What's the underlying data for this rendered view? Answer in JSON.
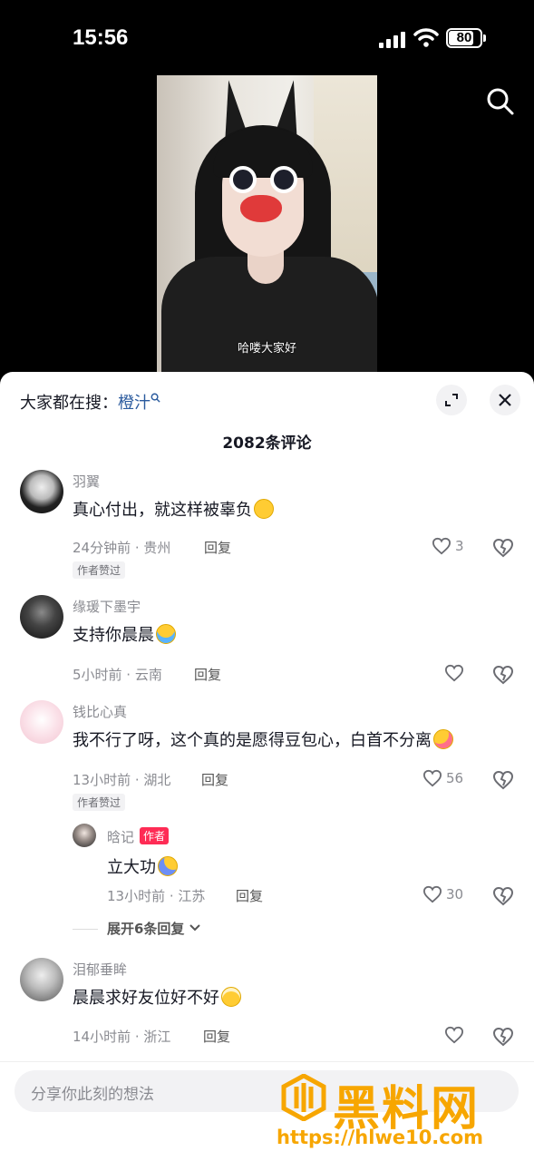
{
  "status_bar": {
    "time": "15:56",
    "battery": "80",
    "battery_level": 0.8
  },
  "video": {
    "subtitle": "哈喽大家好"
  },
  "sheet": {
    "search_prefix": "大家都在搜：",
    "search_keyword": "橙汁",
    "comment_count": "2082条评论"
  },
  "comments": [
    {
      "user": "羽翼",
      "text": "真心付出，就这样被辜负",
      "emoji": "smile-emoji",
      "meta": "24分钟前 · 贵州",
      "reply": "回复",
      "likes": "3",
      "badge": "作者赞过"
    },
    {
      "user": "缘瑗下墨宇",
      "text": "支持你晨晨",
      "emoji": "crying-emoji",
      "meta": "5小时前 · 云南",
      "reply": "回复",
      "likes": ""
    },
    {
      "user": "钱比心真",
      "text": "我不行了呀，这个真的是愿得豆包心，白首不分离",
      "emoji": "tongue-emoji",
      "meta": "13小时前 · 湖北",
      "reply": "回复",
      "likes": "56",
      "badge": "作者赞过"
    },
    {
      "user": "泪郁垂眸",
      "text": "晨晨求好友位好不好",
      "emoji": "pleading-emoji",
      "meta": "14小时前 · 浙江",
      "reply": "回复",
      "likes": ""
    }
  ],
  "sub_reply": {
    "user": "晗记",
    "tag": "作者",
    "text": "立大功",
    "emoji": "hug-emoji",
    "meta": "13小时前 · 江苏",
    "reply": "回复",
    "likes": "30"
  },
  "expand_replies": "展开6条回复",
  "input": {
    "placeholder": "分享你此刻的想法"
  },
  "watermark": {
    "title": "黑料网",
    "url": "https://hlwe10.com"
  },
  "colors": {
    "accent": "#fe2c55",
    "keyword": "#2b5b9e",
    "watermark": "#f7a600"
  }
}
